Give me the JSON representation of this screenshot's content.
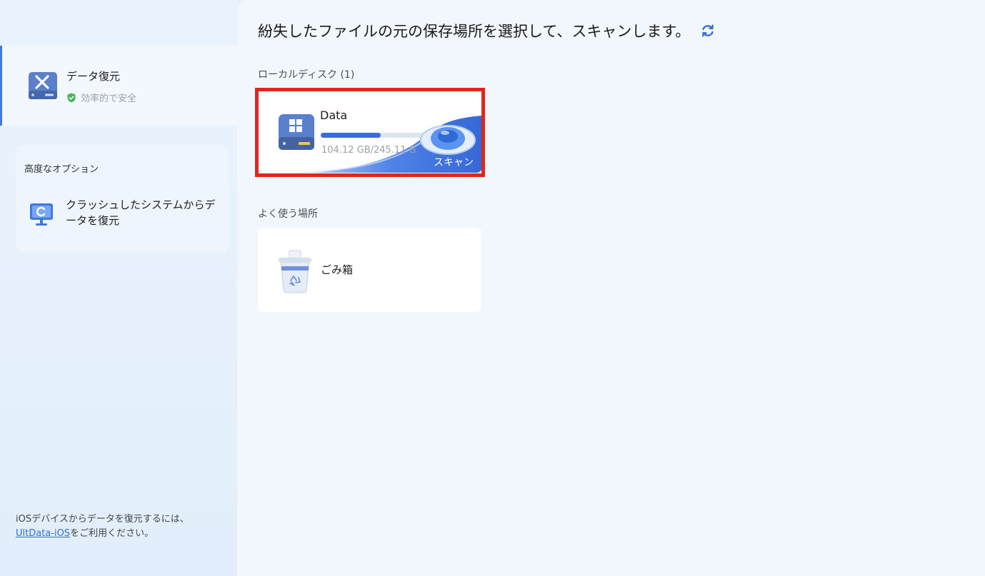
{
  "sidebar": {
    "recovery": {
      "title": "データ復元",
      "subtitle": "効率的で安全"
    },
    "advanced": {
      "heading": "高度なオプション",
      "crash_item": "クラッシュしたシステムからデータを復元"
    },
    "ios_note": {
      "prefix": "iOSデバイスからデータを復元するには、",
      "link": "UltData-iOS",
      "suffix": "をご利用ください。"
    }
  },
  "main": {
    "title": "紛失したファイルの元の保存場所を選択して、スキャンします。",
    "local_disk_label": "ローカルディスク (1)",
    "disk": {
      "name": "Data",
      "size_text": "104.12 GB/245.11 G",
      "used_fraction": 0.42,
      "scan_label": "スキャン"
    },
    "frequent_label": "よく使う場所",
    "trash": {
      "label": "ごみ箱"
    }
  },
  "colors": {
    "accent": "#3a6fd9",
    "highlight": "#e1271b",
    "shield": "#3fb950"
  }
}
